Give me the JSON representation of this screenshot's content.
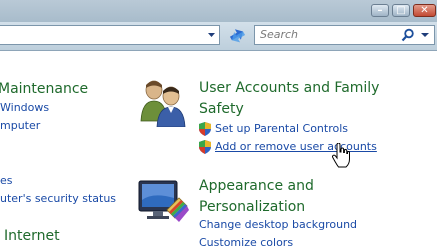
{
  "window": {
    "minimize_label": "–",
    "maximize_label": "□",
    "close_label": "✕"
  },
  "toolbar": {
    "search_placeholder": "Search",
    "refresh_icon": "refresh-arrows-icon",
    "search_icon": "magnifier-icon"
  },
  "left_column": {
    "maintenance_heading": "Maintenance",
    "links": [
      "Windows",
      "mputer",
      "es",
      "uter's security status"
    ],
    "internet_heading": "Internet"
  },
  "user_accounts": {
    "heading_line1": "User Accounts and Family",
    "heading_line2": "Safety",
    "links": [
      "Set up Parental Controls",
      "Add or remove user accounts"
    ]
  },
  "appearance": {
    "heading_line1": "Appearance and",
    "heading_line2": "Personalization",
    "links": [
      "Change desktop background",
      "Customize colors"
    ]
  },
  "colors": {
    "heading_green": "#1f6a2c",
    "link_blue": "#1a4aa6"
  }
}
